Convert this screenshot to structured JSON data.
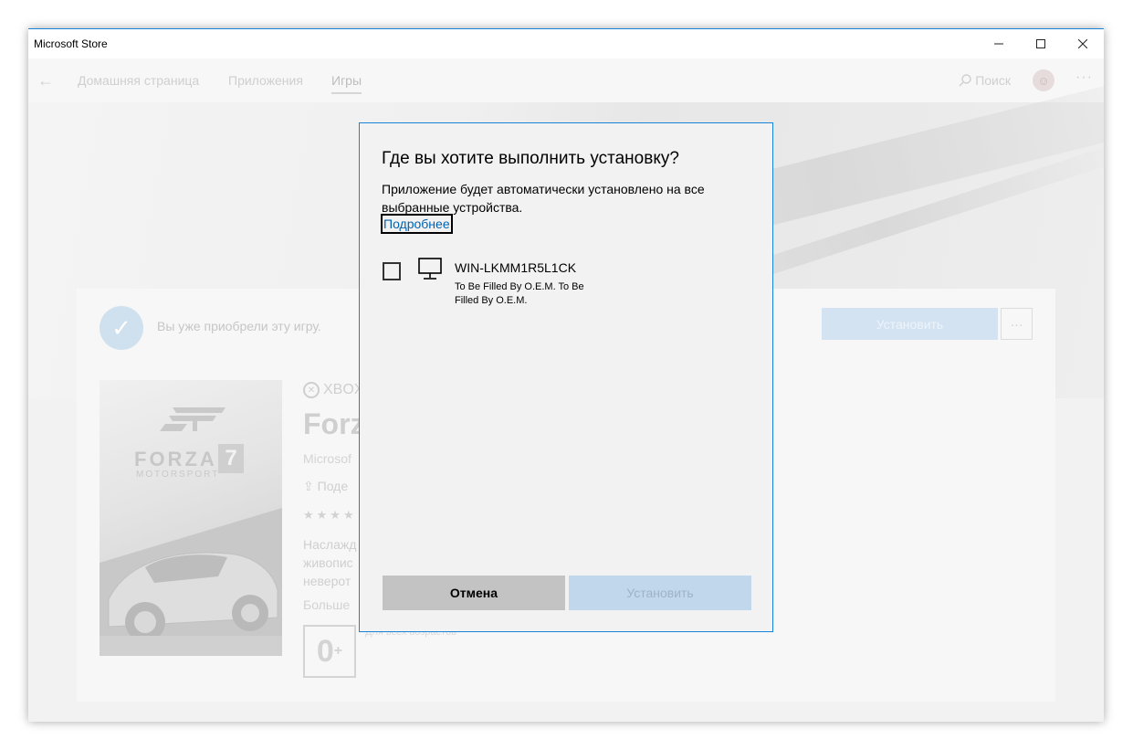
{
  "window": {
    "title": "Microsoft Store"
  },
  "nav": {
    "tabs": [
      {
        "label": "Домашняя страница"
      },
      {
        "label": "Приложения"
      },
      {
        "label": "Игры"
      }
    ],
    "search_label": "Поиск"
  },
  "product": {
    "owned_text": "Вы уже приобрели эту игру.",
    "install_label": "Установить",
    "brand": "XBOX",
    "title_partial": "Forz",
    "publisher_partial": "Microsof",
    "share_partial": "Поде",
    "description_lines": [
      "Наслажд",
      "живопис",
      "неверот"
    ],
    "more_label": "Больше",
    "rating": "0",
    "rating_plus": "+",
    "age_text": "Для всех возрастов",
    "cover": {
      "forza": "FORZA",
      "number": "7",
      "motorsport": "MOTORSPORT"
    }
  },
  "dialog": {
    "title": "Где вы хотите выполнить установку?",
    "description": "Приложение будет автоматически установлено на все выбранные устройства.",
    "learn_more": "Подробнее",
    "device": {
      "name": "WIN-LKMM1R5L1CK",
      "subtitle": "To Be Filled By O.E.M. To Be Filled By O.E.M."
    },
    "cancel_label": "Отмена",
    "install_label": "Установить"
  },
  "icons": {
    "back": "back-arrow-icon",
    "search": "search-icon",
    "device": "desktop-pc-icon"
  },
  "colors": {
    "accent": "#1883d7",
    "link": "#0063b1",
    "install_disabled": "#c0d7ec",
    "cancel_button": "#c3c3c3"
  }
}
